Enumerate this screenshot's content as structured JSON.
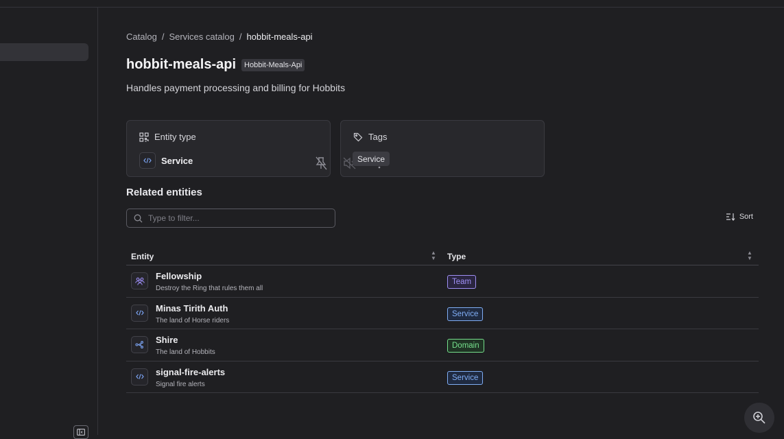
{
  "breadcrumb": {
    "item1": "Catalog",
    "sep1": "/",
    "item2": "Services catalog",
    "sep2": "/",
    "current": "hobbit-meals-api"
  },
  "header": {
    "title": "hobbit-meals-api",
    "badge": "Hobbit-Meals-Api",
    "description": "Handles payment processing and billing for Hobbits"
  },
  "cards": {
    "entity_type": {
      "label": "Entity type",
      "value": "Service"
    },
    "tags": {
      "label": "Tags",
      "tooltip": "Service"
    }
  },
  "related": {
    "title": "Related entities",
    "filter_placeholder": "Type to filter...",
    "sort_label": "Sort",
    "columns": {
      "entity": "Entity",
      "type": "Type"
    },
    "rows": [
      {
        "name": "Fellowship",
        "description": "Destroy the Ring that rules them all",
        "type": "Team",
        "icon": "team-icon"
      },
      {
        "name": "Minas Tirith Auth",
        "description": "The land of Horse riders",
        "type": "Service",
        "icon": "code-icon"
      },
      {
        "name": "Shire",
        "description": "The land of Hobbits",
        "type": "Domain",
        "icon": "domain-icon"
      },
      {
        "name": "signal-fire-alerts",
        "description": "Signal fire alerts",
        "type": "Service",
        "icon": "code-icon"
      }
    ]
  },
  "colors": {
    "accent_team": "#a090f5",
    "accent_service": "#80aef5",
    "accent_domain": "#76e08c"
  }
}
